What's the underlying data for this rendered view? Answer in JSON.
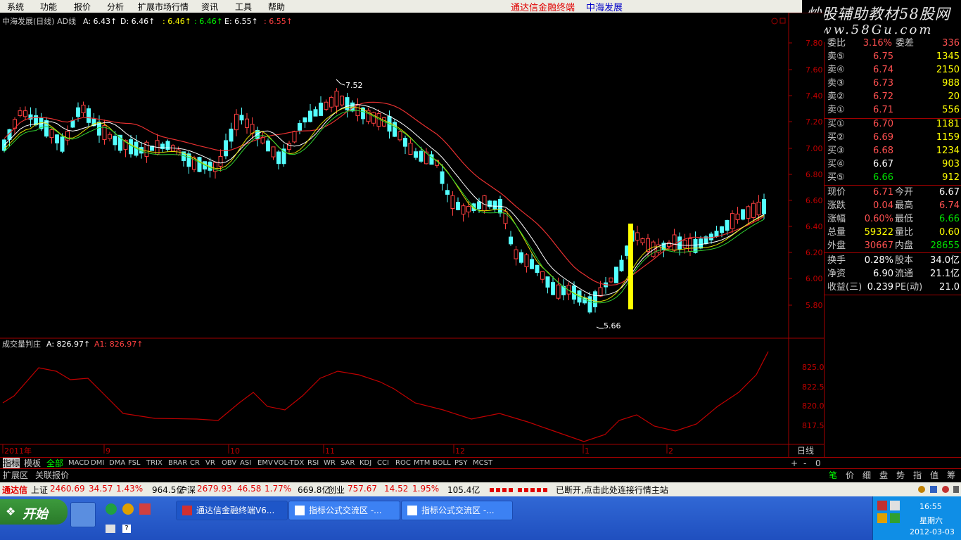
{
  "menu": [
    "系统",
    "功能",
    "报价",
    "分析",
    "扩展市场行情",
    "资讯",
    "工具",
    "帮助"
  ],
  "app_title": "通达信金融终端",
  "stock_name": "中海发展",
  "brand": {
    "line1": "炒股辅助教材58股网",
    "line2": "www.58Gu.com"
  },
  "main_chart": {
    "header": "中海发展(日线) AD线 A: 6.43↑ D: 6.46↑ : 6.46↑ : 6.46↑ E: 6.55↑ : 6.55↑",
    "header_parts": [
      {
        "text": "中海发展(日线) AD线",
        "color": "#c8c8c8"
      },
      {
        "text": "A: 6.43↑",
        "color": "#ffffff"
      },
      {
        "text": "D: 6.46↑",
        "color": "#ffffff"
      },
      {
        "text": ": 6.46↑",
        "color": "#ffff00"
      },
      {
        "text": ": 6.46↑",
        "color": "#00ff00"
      },
      {
        "text": "E: 6.55↑",
        "color": "#ffffff"
      },
      {
        "text": ": 6.55↑",
        "color": "#ff4040"
      }
    ],
    "y_ticks": [
      "7.80",
      "7.60",
      "7.40",
      "7.20",
      "7.00",
      "6.80",
      "6.60",
      "6.40",
      "6.20",
      "6.00",
      "5.80"
    ],
    "high_label": "7.52",
    "low_label": "5.66"
  },
  "indicator": {
    "header_parts": [
      {
        "text": "成交量判庄",
        "color": "#c8c8c8"
      },
      {
        "text": "A: 826.97↑",
        "color": "#ffffff"
      },
      {
        "text": "A1: 826.97↑",
        "color": "#ff4040"
      }
    ],
    "y_ticks": [
      "825.0",
      "822.5",
      "820.0",
      "817.5"
    ]
  },
  "x_axis": [
    "2011年",
    "9",
    "10",
    "11",
    "12",
    "1",
    "2"
  ],
  "period": "日线",
  "tabs": [
    "指标",
    "模板",
    "全部",
    "MACD",
    "DMI",
    "DMA",
    "FSL",
    "TRIX",
    "BRAR",
    "CR",
    "VR",
    "OBV",
    "ASI",
    "EMV",
    "VOL-TDX",
    "RSI",
    "WR",
    "SAR",
    "KDJ",
    "CCI",
    "ROC",
    "MTM",
    "BOLL",
    "PSY",
    "MCST"
  ],
  "tab_controls": [
    "+",
    "-",
    "0"
  ],
  "bottom_left": [
    "扩展区",
    "关联报价"
  ],
  "bottom_right_tabs": [
    "笔",
    "价",
    "细",
    "盘",
    "势",
    "指",
    "值",
    "筹"
  ],
  "quote": {
    "top_row": {
      "label": "委比",
      "value": "3.16%",
      "label2": "委差",
      "value2": "336"
    },
    "asks": [
      {
        "label": "卖⑤",
        "price": "6.75",
        "vol": "1345"
      },
      {
        "label": "卖④",
        "price": "6.74",
        "vol": "2150"
      },
      {
        "label": "卖③",
        "price": "6.73",
        "vol": "988"
      },
      {
        "label": "卖②",
        "price": "6.72",
        "vol": "20"
      },
      {
        "label": "卖①",
        "price": "6.71",
        "vol": "556"
      }
    ],
    "bids": [
      {
        "label": "买①",
        "price": "6.70",
        "vol": "1181"
      },
      {
        "label": "买②",
        "price": "6.69",
        "vol": "1159"
      },
      {
        "label": "买③",
        "price": "6.68",
        "vol": "1234"
      },
      {
        "label": "买④",
        "price": "6.67",
        "vol": "903"
      },
      {
        "label": "买⑤",
        "price": "6.66",
        "vol": "912"
      }
    ],
    "stats": [
      {
        "l1": "现价",
        "v1": "6.71",
        "c1": "#ff5050",
        "l2": "今开",
        "v2": "6.67",
        "c2": "#ffffff"
      },
      {
        "l1": "涨跌",
        "v1": "0.04",
        "c1": "#ff5050",
        "l2": "最高",
        "v2": "6.74",
        "c2": "#ff5050"
      },
      {
        "l1": "涨幅",
        "v1": "0.60%",
        "c1": "#ff5050",
        "l2": "最低",
        "v2": "6.66",
        "c2": "#00e000"
      },
      {
        "l1": "总量",
        "v1": "59322",
        "c1": "#ffff00",
        "l2": "量比",
        "v2": "0.60",
        "c2": "#ffff00"
      },
      {
        "l1": "外盘",
        "v1": "30667",
        "c1": "#ff5050",
        "l2": "内盘",
        "v2": "28655",
        "c2": "#00e000"
      }
    ],
    "stats2": [
      {
        "l1": "换手",
        "v1": "0.28%",
        "l2": "股本",
        "v2": "34.0亿"
      },
      {
        "l1": "净资",
        "v1": "6.90",
        "l2": "流通",
        "v2": "21.1亿"
      },
      {
        "l1": "收益(三)",
        "v1": "0.239",
        "l2": "PE(动)",
        "v2": "21.0"
      }
    ]
  },
  "status_bar": [
    {
      "text": "通达信",
      "color": "#e00000"
    },
    {
      "text": "上证",
      "color": "#000000"
    },
    {
      "text": "2460.69",
      "color": "#e00000"
    },
    {
      "text": "34.57",
      "color": "#e00000"
    },
    {
      "text": "1.43%",
      "color": "#e00000"
    },
    {
      "text": "964.5亿",
      "color": "#000000"
    },
    {
      "text": "沪深",
      "color": "#000000"
    },
    {
      "text": "2679.93",
      "color": "#e00000"
    },
    {
      "text": "46.58",
      "color": "#e00000"
    },
    {
      "text": "1.77%",
      "color": "#e00000"
    },
    {
      "text": "669.8亿",
      "color": "#000000"
    },
    {
      "text": "创业",
      "color": "#000000"
    },
    {
      "text": "757.67",
      "color": "#e00000"
    },
    {
      "text": "14.52",
      "color": "#e00000"
    },
    {
      "text": "1.95%",
      "color": "#e00000"
    },
    {
      "text": "105.4亿",
      "color": "#000000"
    },
    {
      "text": "已断开,点击此处连接行情主站",
      "color": "#000000"
    }
  ],
  "taskbar": {
    "start": "开始",
    "tasks": [
      "通达信金融终端V6...",
      "指标公式交流区 -...",
      "指标公式交流区 -..."
    ],
    "time": "16:55",
    "weekday": "星期六",
    "date": "2012-03-03"
  }
}
